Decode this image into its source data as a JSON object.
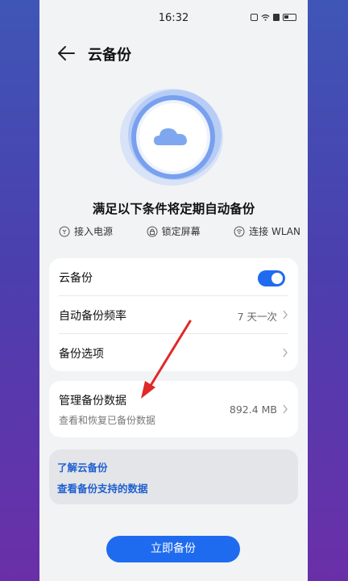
{
  "status_bar": {
    "time": "16:32"
  },
  "header": {
    "title": "云备份",
    "back_icon": "arrow-left-icon"
  },
  "hero": {
    "icon": "cloud-icon"
  },
  "conditions": {
    "title": "满足以下条件将定期自动备份",
    "items": [
      {
        "label": "接入电源",
        "icon": "power-plug-icon"
      },
      {
        "label": "锁定屏幕",
        "icon": "lock-icon"
      },
      {
        "label": "连接 WLAN",
        "icon": "wifi-icon"
      }
    ]
  },
  "settings": {
    "cloud_backup_label": "云备份",
    "cloud_backup_enabled": true,
    "frequency_label": "自动备份频率",
    "frequency_value": "7 天一次",
    "options_label": "备份选项"
  },
  "manage": {
    "label": "管理备份数据",
    "subtitle": "查看和恢复已备份数据",
    "size": "892.4 MB"
  },
  "links": {
    "learn": "了解云备份",
    "supported": "查看备份支持的数据"
  },
  "primary_button": "立即备份",
  "colors": {
    "accent": "#1f6bf0",
    "annotation": "#e02828"
  }
}
